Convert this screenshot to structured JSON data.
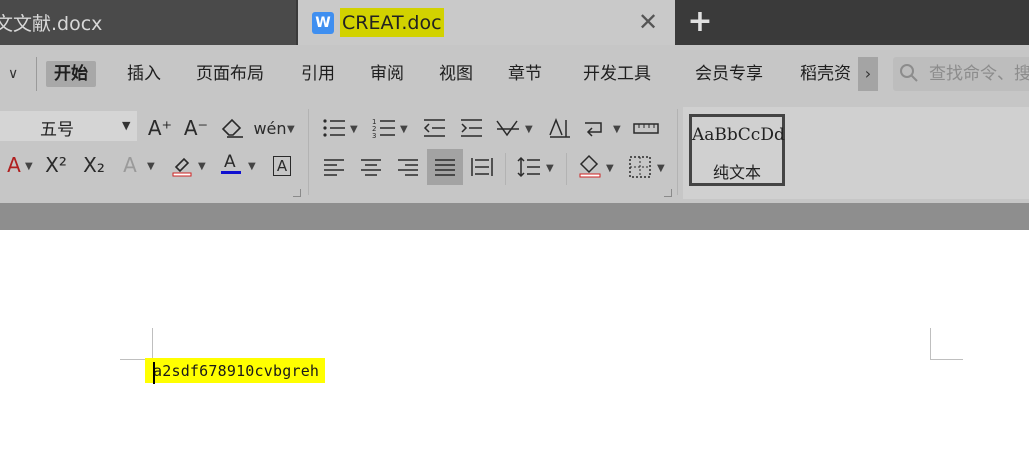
{
  "tabs": {
    "inactive_title": "文文献.docx",
    "active_title": "CREAT.doc",
    "active_icon_letter": "W",
    "close_glyph": "✕",
    "add_glyph": "+"
  },
  "menu": {
    "collapse_glyph": "∨",
    "items": [
      "开始",
      "插入",
      "页面布局",
      "引用",
      "审阅",
      "视图",
      "章节",
      "开发工具",
      "会员专享",
      "稻壳资"
    ],
    "more_glyph": "›",
    "search_placeholder": "查找命令、搜"
  },
  "ribbon": {
    "font_size_value": "五号",
    "style_sample": "AaBbCcDd",
    "style_name": "纯文本",
    "icons": {
      "grow_font": "A⁺",
      "shrink_font": "A⁻",
      "superscript": "X²",
      "subscript": "X₂"
    }
  },
  "document": {
    "text": "a2sdf678910cvbgreh",
    "highlight_color": "#ffff00"
  },
  "colors": {
    "tabbar_bg": "#3a3a3a",
    "active_tab_bg": "#c9c9c9",
    "ribbon_bg": "#c6c6c6",
    "title_highlight": "#d2d200",
    "word_blue": "#3f8ff0"
  }
}
